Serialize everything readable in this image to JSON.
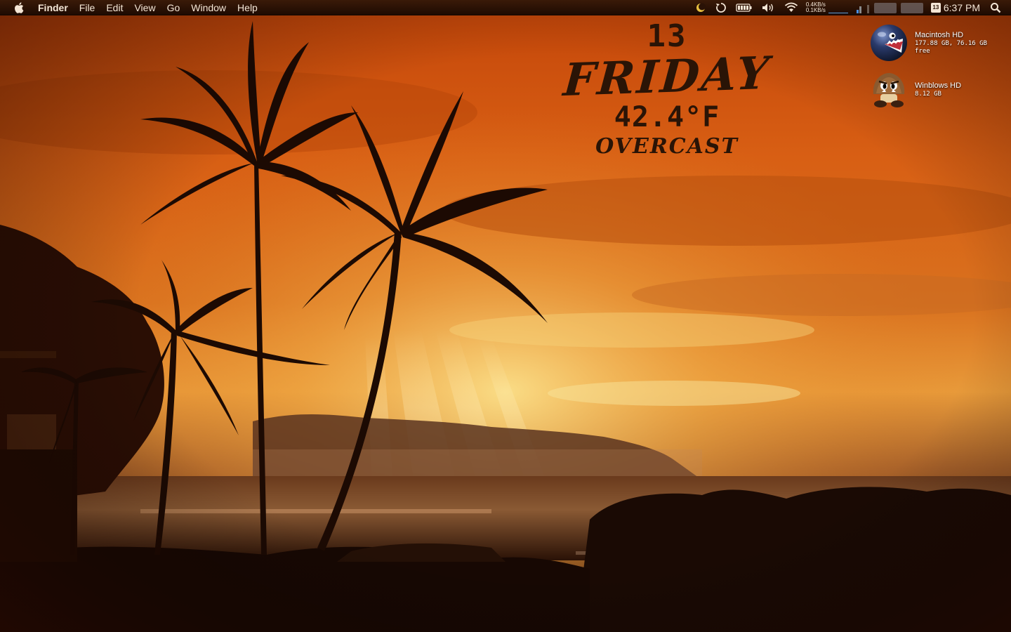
{
  "menubar": {
    "app_name": "Finder",
    "menus": [
      "File",
      "Edit",
      "View",
      "Go",
      "Window",
      "Help"
    ],
    "net_up": "0.4KB/s",
    "net_down": "0.1KB/s",
    "calendar_day": "13",
    "clock": "6:37 PM"
  },
  "widget": {
    "day_number": "13",
    "weekday": "FRIDAY",
    "temperature": "42.4°F",
    "condition": "OVERCAST"
  },
  "desktop": {
    "icons": [
      {
        "name": "Macintosh HD",
        "detail": "177.88 GB, 76.16 GB free",
        "icon": "chain-chomp-drive-icon"
      },
      {
        "name": "Winblows HD",
        "detail": "8.12 GB",
        "icon": "goomba-drive-icon"
      }
    ]
  },
  "colors": {
    "sky_top": "#c54a0a",
    "sky_mid": "#e0741a",
    "sun_glow": "#f2c25a",
    "silhouette": "#1c0a03",
    "menubar_bg": "#2a1206",
    "widget_text": "#2a1406"
  }
}
